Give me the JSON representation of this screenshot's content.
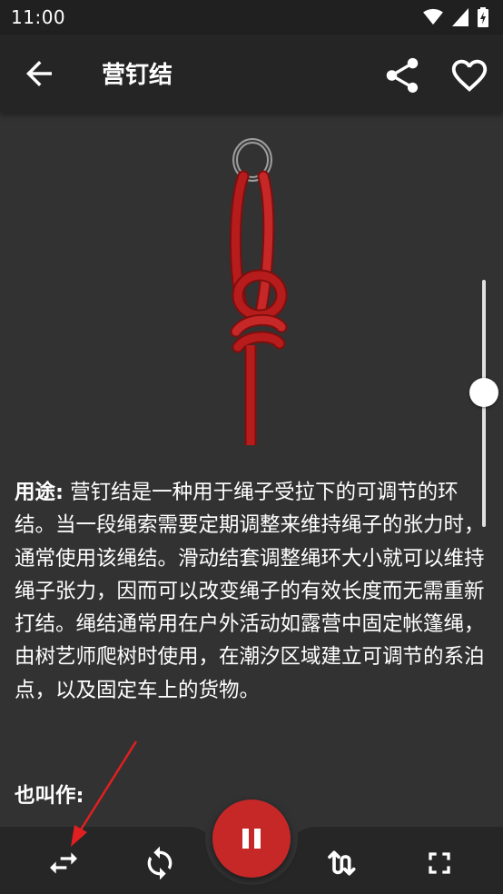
{
  "status_bar": {
    "time": "11:00",
    "icons": [
      "wifi-icon",
      "signal-icon",
      "battery-charging-icon"
    ]
  },
  "app_bar": {
    "title": "营钉结",
    "back_icon": "arrow-back-icon",
    "share_icon": "share-icon",
    "favorite_icon": "heart-outline-icon"
  },
  "knot_view": {
    "rope_color": "#b71c1c",
    "speed_slider_level": 0.5
  },
  "description": {
    "label": "用途:",
    "text": " 营钉结是一种用于绳子受拉下的可调节的环结。当一段绳索需要定期调整来维持绳子的张力时，通常使用该绳结。滑动结套调整绳环大小就可以维持绳子张力，因而可以改变绳子的有效长度而无需重新打结。绳结通常用在户外活动如露营中固定帐篷绳，由树艺师爬树时使用，在潮汐区域建立可调节的系泊点，以及固定车上的货物。"
  },
  "also_known_as": {
    "label": "也叫作:"
  },
  "bottom_bar": {
    "left_icons": [
      "swap-horiz-icon",
      "rotate-icon"
    ],
    "center_icon": "pause-icon",
    "right_icons": [
      "step-sequence-icon",
      "fullscreen-icon"
    ],
    "accent_color": "#c62828"
  },
  "annotation": {
    "arrow_color": "#e02020"
  }
}
